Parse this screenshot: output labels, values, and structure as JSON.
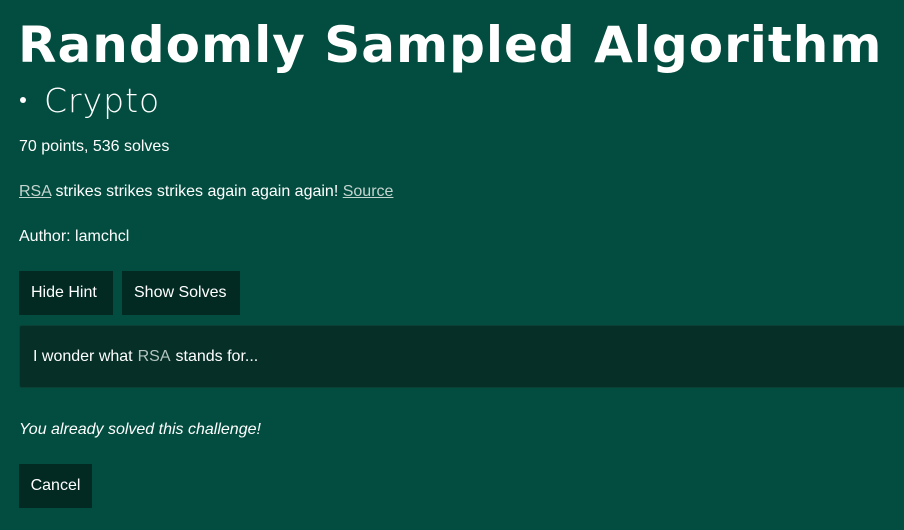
{
  "challenge": {
    "title": "Randomly Sampled Algorithm",
    "category": "Crypto",
    "stats": "70 points, 536 solves",
    "description": {
      "link_rsa": "RSA",
      "text": "strikes strikes strikes again again again!",
      "link_source": "Source"
    },
    "author": "Author: lamchcl"
  },
  "buttons": {
    "hide_hint": "Hide Hint",
    "show_solves": "Show Solves",
    "cancel": "Cancel"
  },
  "hint": {
    "prefix": "I wonder what",
    "highlight": "RSA",
    "suffix": "stands for..."
  },
  "status": {
    "solved_message": "You already solved this challenge!"
  },
  "colors": {
    "background": "#024d3f",
    "button_bg": "#022a22",
    "hint_bg": "#052f27",
    "link": "#c4d4cf"
  }
}
